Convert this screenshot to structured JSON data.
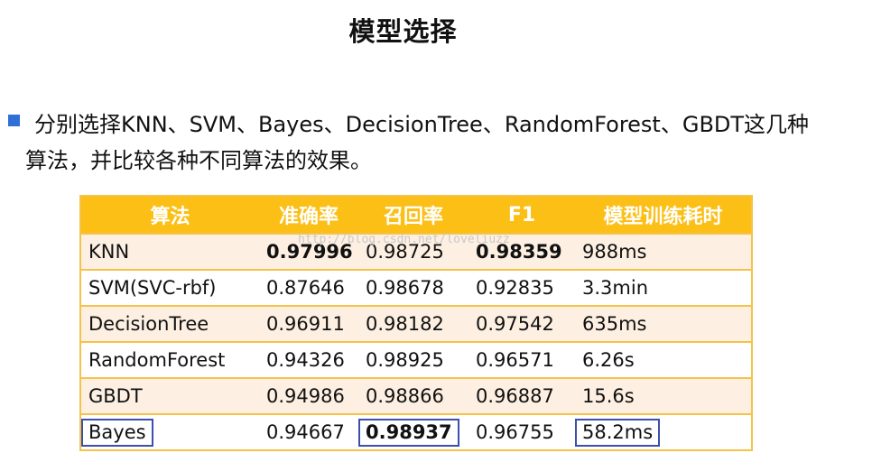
{
  "title": "模型选择",
  "intro": {
    "line1": "分别选择KNN、SVM、Bayes、DecisionTree、RandomForest、GBDT这几种",
    "line2": "算法，并比较各种不同算法的效果。"
  },
  "watermark": "http://blog.csdn.net/loveliuzz",
  "table": {
    "headers": [
      "算法",
      "准确率",
      "召回率",
      "F1",
      "模型训练耗时"
    ],
    "rows": [
      [
        "KNN",
        "0.97996",
        "0.98725",
        "0.98359",
        "988ms"
      ],
      [
        "SVM(SVC-rbf)",
        "0.87646",
        "0.98678",
        "0.92835",
        "3.3min"
      ],
      [
        "DecisionTree",
        "0.96911",
        "0.98182",
        "0.97542",
        "635ms"
      ],
      [
        "RandomForest",
        "0.94326",
        "0.98925",
        "0.96571",
        "6.26s"
      ],
      [
        "GBDT",
        "0.94986",
        "0.98866",
        "0.96887",
        "15.6s"
      ],
      [
        "Bayes",
        "0.94667",
        "0.98937",
        "0.96755",
        "58.2ms"
      ]
    ],
    "highlight_color": "#fbbf16",
    "box_color": "#3b4fb0"
  }
}
